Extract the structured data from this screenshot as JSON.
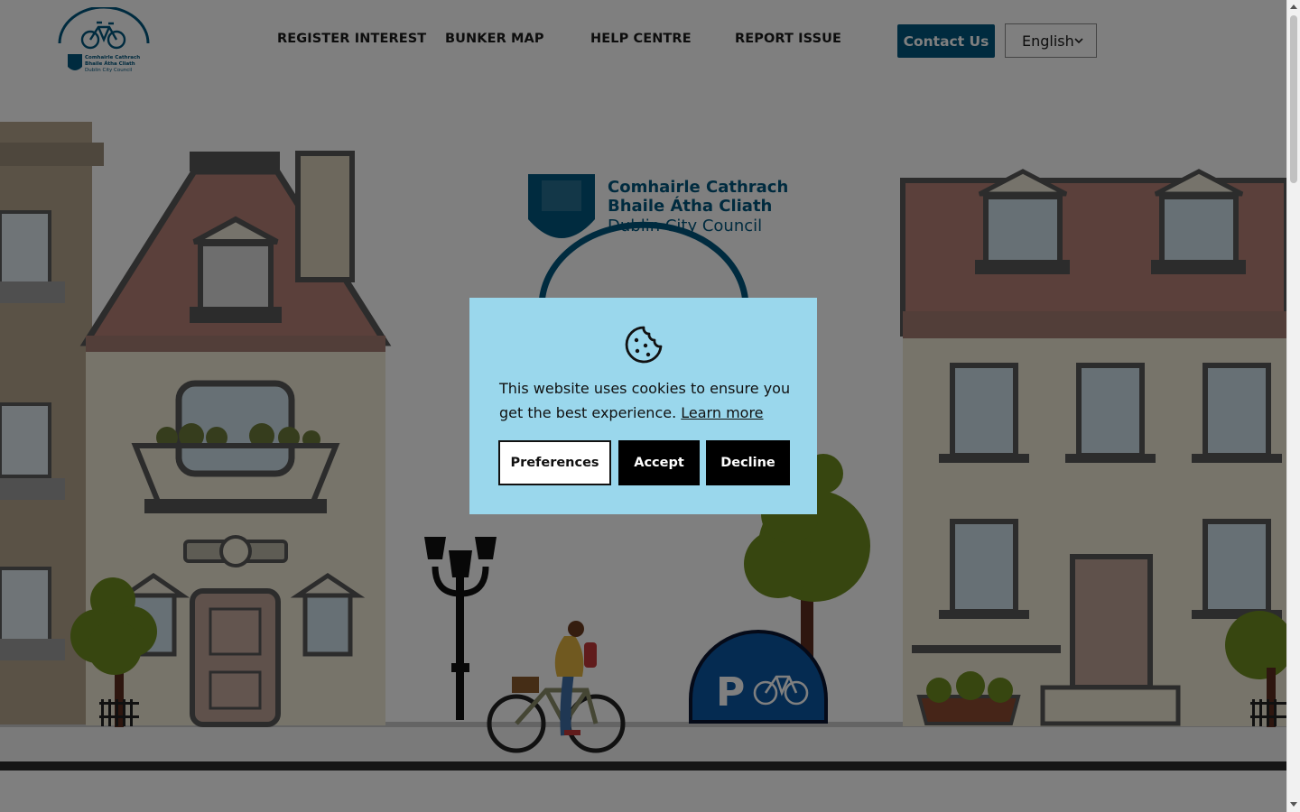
{
  "header": {
    "nav": [
      {
        "label": "REGISTER INTEREST"
      },
      {
        "label": "BUNKER MAP"
      },
      {
        "label": "HELP CENTRE"
      },
      {
        "label": "REPORT ISSUE"
      }
    ],
    "contact_label": "Contact Us",
    "language": {
      "selected": "English"
    },
    "logo": {
      "line1": "Comhairle Cathrach",
      "line2": "Bhaile Átha Cliath",
      "line3": "Dublin City Council"
    }
  },
  "hero": {
    "council": {
      "line1": "Comhairle Cathrach",
      "line2": "Bhaile Átha Cliath",
      "line3": "Dublin City Council"
    },
    "parking_letter": "P"
  },
  "cookie": {
    "message": "This website uses cookies to ensure you get the best experience.",
    "learn_more": "Learn more",
    "preferences_label": "Preferences",
    "accept_label": "Accept",
    "decline_label": "Decline"
  },
  "colors": {
    "brand": "#00567e",
    "cookie_bg": "#9ad7ec",
    "overlay": "rgba(0,0,0,0.5)"
  }
}
